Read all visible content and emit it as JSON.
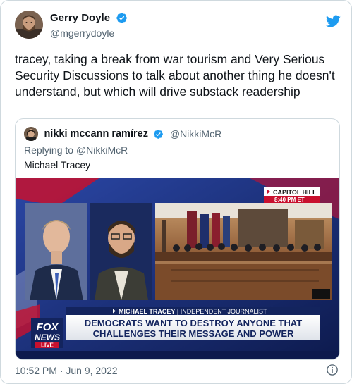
{
  "tweet": {
    "author": {
      "display_name": "Gerry Doyle",
      "handle": "@mgerrydoyle",
      "verified": true
    },
    "text": "tracey, taking a break from war tourism and Very Serious Security Discussions to talk about another thing he doesn't understand, but which will drive substack readership",
    "timestamp": "10:52 PM · Jun 9, 2022"
  },
  "quoted_tweet": {
    "author": {
      "display_name": "nikki mccann ramírez",
      "handle": "@NikkiMcR",
      "verified": true
    },
    "replying_prefix": "Replying to ",
    "replying_to": "@NikkiMcR",
    "text": "Michael Tracey",
    "media": {
      "location_banner": "CAPITOL HILL",
      "time_banner": "8:40 PM ET",
      "lower_third_name": "MICHAEL TRACEY",
      "lower_third_title": "INDEPENDENT JOURNALIST",
      "headline_line1": "DEMOCRATS WANT TO DESTROY ANYONE THAT",
      "headline_line2": "CHALLENGES THEIR MESSAGE AND POWER",
      "logo_fox": "FOX",
      "logo_news": "NEWS",
      "logo_live": "LIVE"
    }
  },
  "colors": {
    "twitter_blue": "#1d9bf0",
    "fox_red": "#c8102e",
    "fox_navy": "#13245e"
  },
  "icons": {
    "brand": "twitter-bird-icon",
    "verified": "verified-badge-icon",
    "info": "info-icon"
  }
}
